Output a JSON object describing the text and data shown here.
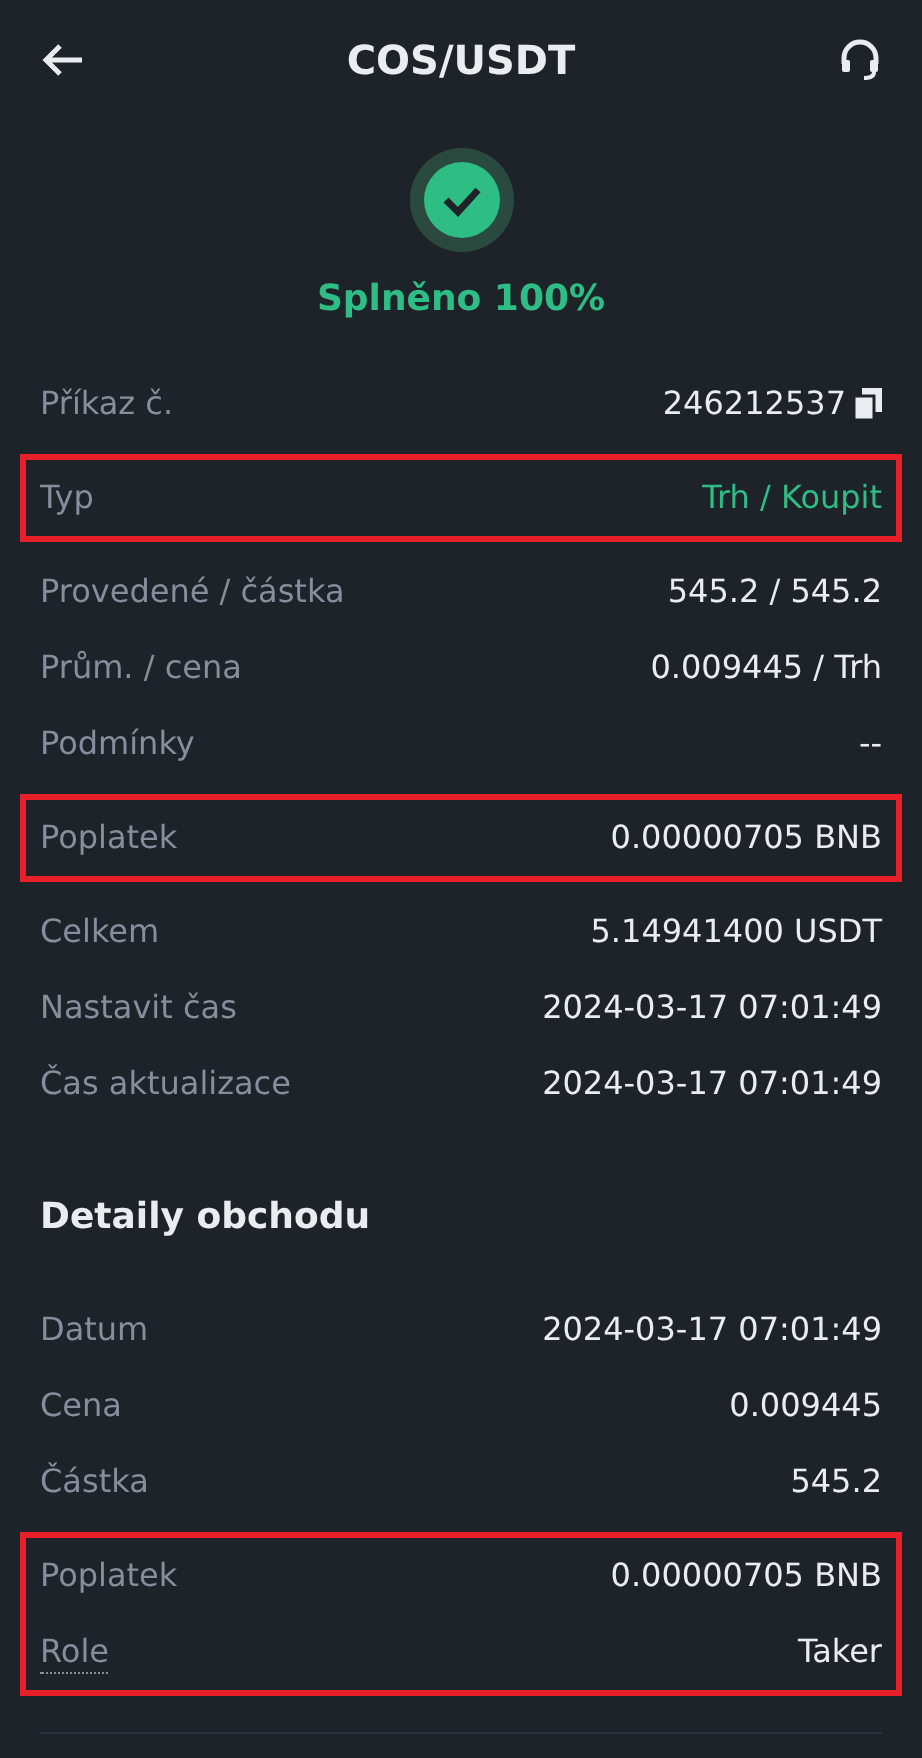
{
  "header": {
    "title": "COS/USDT"
  },
  "status": {
    "text": "Splněno 100%",
    "done": true
  },
  "blocks": [
    {
      "highlighted": false,
      "rows": [
        {
          "label": "Příkaz č.",
          "value": "246212537",
          "copyable": true
        }
      ]
    },
    {
      "highlighted": true,
      "rows": [
        {
          "label": "Typ",
          "value": "Trh / Koupit",
          "color": "#2ebd85"
        }
      ]
    },
    {
      "highlighted": false,
      "rows": [
        {
          "label": "Provedené / částka",
          "value": "545.2 / 545.2"
        },
        {
          "label": "Prům. / cena",
          "value": "0.009445 / Trh"
        },
        {
          "label": "Podmínky",
          "value": "--"
        }
      ]
    },
    {
      "highlighted": true,
      "rows": [
        {
          "label": "Poplatek",
          "value": "0.00000705 BNB"
        }
      ]
    },
    {
      "highlighted": false,
      "rows": [
        {
          "label": "Celkem",
          "value": "5.14941400 USDT"
        },
        {
          "label": "Nastavit čas",
          "value": "2024-03-17 07:01:49"
        },
        {
          "label": "Čas aktualizace",
          "value": "2024-03-17 07:01:49"
        }
      ]
    },
    {
      "heading": "Detaily obchodu",
      "highlighted": false,
      "rows": [
        {
          "label": "Datum",
          "value": "2024-03-17 07:01:49"
        },
        {
          "label": "Cena",
          "value": "0.009445"
        },
        {
          "label": "Částka",
          "value": "545.2"
        }
      ]
    },
    {
      "highlighted": true,
      "rows": [
        {
          "label": "Poplatek",
          "value": "0.00000705 BNB"
        },
        {
          "label": "Role",
          "value": "Taker",
          "underlined": true
        }
      ]
    }
  ]
}
